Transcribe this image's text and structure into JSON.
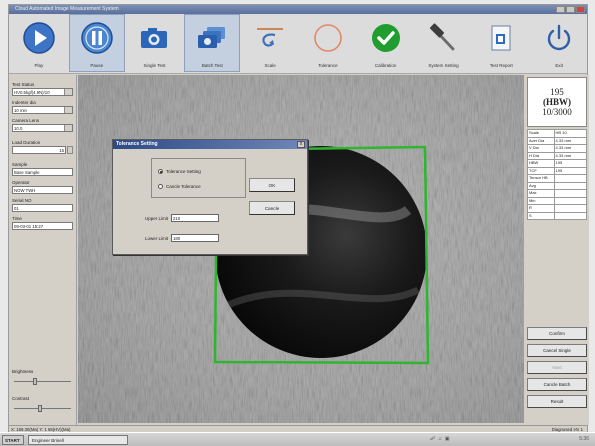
{
  "window": {
    "title": "Cloud Automated Image Measurement System"
  },
  "toolbar": {
    "buttons": [
      {
        "label": "Play",
        "icon": "play-icon"
      },
      {
        "label": "Pause",
        "icon": "pause-icon"
      },
      {
        "label": "Single Test",
        "icon": "camera-icon"
      },
      {
        "label": "Batch Test",
        "icon": "multi-camera-icon"
      },
      {
        "label": "Scale",
        "icon": "scale-icon"
      },
      {
        "label": "Tolerance",
        "icon": "tolerance-circle-icon"
      },
      {
        "label": "Calibration",
        "icon": "checkmark-icon"
      },
      {
        "label": "System Setting",
        "icon": "hammer-icon"
      },
      {
        "label": "Test Report",
        "icon": "report-icon"
      },
      {
        "label": "Exit",
        "icon": "power-icon"
      }
    ]
  },
  "leftpanel": {
    "test_status_label": "Test Status",
    "test_status_value": "HV0.5kgf(4.9N)/10",
    "indenter_label": "Indenter dia",
    "indenter_value": "10 min",
    "camera_lens_label": "Camera Lens",
    "camera_lens_value": "10.0",
    "load_duration_label": "Load Duration",
    "load_duration_value": "15",
    "sample_label": "Sample",
    "sample_value": "Base Sample",
    "operator_label": "Operator",
    "operator_value": "NOW TWH",
    "serial_label": "Serial NO",
    "serial_value": "01",
    "time_label": "Time",
    "time_value": "09-03-01 15:27",
    "brightness_label": "Brightness",
    "contrast_label": "Contrast"
  },
  "controls": {
    "brightness": 0.35,
    "contrast": 0.45
  },
  "rightpanel": {
    "box_line1": "195",
    "box_line2": "(HBW)",
    "box_line3": "10/3000",
    "results": [
      {
        "k": "Scale",
        "v": "HB 10"
      },
      {
        "k": "Aver Dia",
        "v": "4.33 mm"
      },
      {
        "k": "V Dia",
        "v": "4.33 mm"
      },
      {
        "k": "H Dia",
        "v": "4.33 mm"
      },
      {
        "k": "HBW",
        "v": "195"
      },
      {
        "k": "TCF",
        "v": "195"
      },
      {
        "k": "Tensor HB",
        "v": ""
      },
      {
        "k": "Avg",
        "v": ""
      },
      {
        "k": "Max",
        "v": ""
      },
      {
        "k": "Min",
        "v": ""
      },
      {
        "k": "R",
        "v": ""
      },
      {
        "k": "S",
        "v": ""
      }
    ],
    "buttons": [
      {
        "label": "Confirm",
        "disabled": false
      },
      {
        "label": "Cancel Single",
        "disabled": false
      },
      {
        "label": "Next",
        "disabled": true
      },
      {
        "label": "Cancle Batch",
        "disabled": false
      },
      {
        "label": "Result",
        "disabled": false
      }
    ]
  },
  "dialog": {
    "title": "Tolerance Setting",
    "close_glyph": "x",
    "radio_tolerance": "Tolerance Setting",
    "radio_cancel": "Cancle Tolerance",
    "ok_label": "OK",
    "cancel_label": "Cancle",
    "upper_label": "Upper Limit",
    "upper_value": "210",
    "lower_label": "Lower Limit",
    "lower_value": "180"
  },
  "statusbar": {
    "left": "X: 159,30(Ma)  Y: 1 65(HV)(Ma)",
    "right": "Diagnosed  HV 1"
  },
  "taskbar": {
    "start": "START",
    "task": "Engineer Brinell",
    "clock": "5:36"
  },
  "colors": {
    "outline": "#2fb52f",
    "accent": "#4a7fc0",
    "check": "#1f9e2f"
  }
}
